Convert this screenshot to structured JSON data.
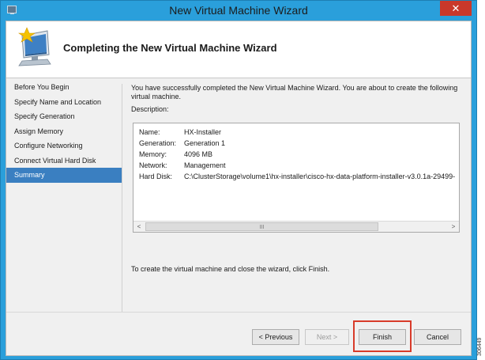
{
  "window": {
    "title": "New Virtual Machine Wizard",
    "close_glyph": "✕"
  },
  "header": {
    "title": "Completing the New Virtual Machine Wizard"
  },
  "nav": {
    "items": [
      {
        "label": "Before You Begin"
      },
      {
        "label": "Specify Name and Location"
      },
      {
        "label": "Specify Generation"
      },
      {
        "label": "Assign Memory"
      },
      {
        "label": "Configure Networking"
      },
      {
        "label": "Connect Virtual Hard Disk"
      },
      {
        "label": "Summary",
        "selected": true
      }
    ]
  },
  "content": {
    "intro": "You have successfully completed the New Virtual Machine Wizard. You are about to create the following virtual machine.",
    "description_label": "Description:",
    "rows": [
      {
        "key": "Name:",
        "value": "HX-Installer"
      },
      {
        "key": "Generation:",
        "value": "Generation 1"
      },
      {
        "key": "Memory:",
        "value": "4096 MB"
      },
      {
        "key": "Network:",
        "value": "Management"
      },
      {
        "key": "Hard Disk:",
        "value": "C:\\ClusterStorage\\volume1\\hx-installer\\cisco-hx-data-platform-installer-v3.0.1a-29499-"
      }
    ],
    "scroll_left": "<",
    "scroll_right": ">",
    "scroll_grip": "III",
    "finish_note": "To create the virtual machine and close the wizard, click Finish."
  },
  "buttons": {
    "previous": "< Previous",
    "next": "Next >",
    "finish": "Finish",
    "cancel": "Cancel"
  },
  "side_code": "306449",
  "colors": {
    "titlebar": "#2a9fdb",
    "selected": "#3a7fc1",
    "highlight": "#d83b2a",
    "close": "#c9382a"
  }
}
